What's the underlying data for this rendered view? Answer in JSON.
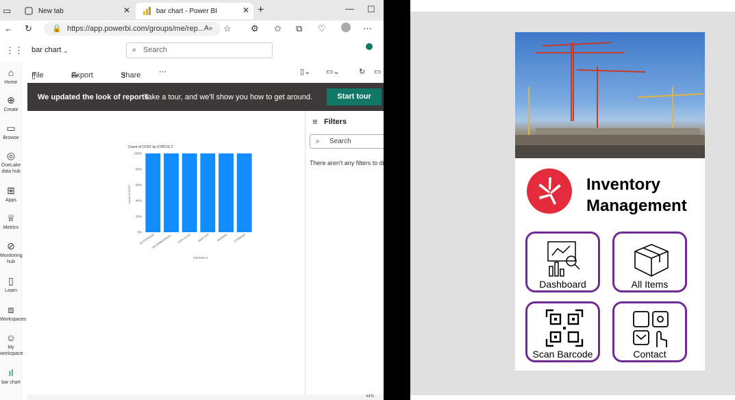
{
  "browser": {
    "tabs": [
      {
        "label": "New tab"
      },
      {
        "label": "bar chart - Power BI"
      }
    ],
    "url": "https://app.powerbi.com/groups/me/rep...",
    "reader_label": "A»"
  },
  "pbi": {
    "report_name": "bar chart",
    "search_placeholder": "Search",
    "nav": [
      {
        "label": "Home",
        "icon": "home-icon"
      },
      {
        "label": "Create",
        "icon": "plus-circle-icon"
      },
      {
        "label": "Browse",
        "icon": "folder-icon"
      },
      {
        "label": "OneLake data hub",
        "icon": "onelake-icon"
      },
      {
        "label": "Apps",
        "icon": "apps-icon"
      },
      {
        "label": "Metrics",
        "icon": "trophy-icon"
      },
      {
        "label": "Monitoring hub",
        "icon": "monitor-icon"
      },
      {
        "label": "Learn",
        "icon": "book-icon"
      },
      {
        "label": "Workspaces",
        "icon": "workspaces-icon"
      },
      {
        "label": "My workspace",
        "icon": "person-icon"
      },
      {
        "label": "bar chart",
        "icon": "bar-chart-icon"
      }
    ],
    "toolbar": {
      "file": "File",
      "export": "Export",
      "share": "Share"
    },
    "banner": {
      "bold": "We updated the look of reports",
      "message": "Take a tour, and we'll show you how to get around.",
      "button": "Start tour"
    },
    "filters": {
      "title": "Filters",
      "search": "Search",
      "empty": "There aren't any filters to dis"
    },
    "zoom": "44%"
  },
  "chart_data": {
    "type": "bar",
    "title": "Count of COST by STATUS 2",
    "xlabel": "STATUS 2",
    "ylabel": "Count of COST",
    "categories": [
      "IN STORAGE",
      "DECOMMISSION...",
      "DEPLOYED",
      "INACTIVE",
      "MISSING",
      "STORAGE"
    ],
    "values": [
      100,
      100,
      100,
      100,
      100,
      100
    ],
    "yticks": [
      "0%",
      "20%",
      "40%",
      "60%",
      "80%",
      "100%"
    ],
    "ylim": [
      0,
      100
    ],
    "color": "#118dff",
    "grid": false
  },
  "app": {
    "title_line1": "Inventory",
    "title_line2": "Management",
    "accent": "#6f2b91",
    "logo_color": "#e32b3c",
    "buttons": [
      {
        "label": "Dashboard",
        "icon": "dashboard-icon"
      },
      {
        "label": "All Items",
        "icon": "box-icon"
      },
      {
        "label": "Scan Barcode",
        "icon": "qr-code-icon"
      },
      {
        "label": "Contact",
        "icon": "contact-icon"
      }
    ]
  }
}
